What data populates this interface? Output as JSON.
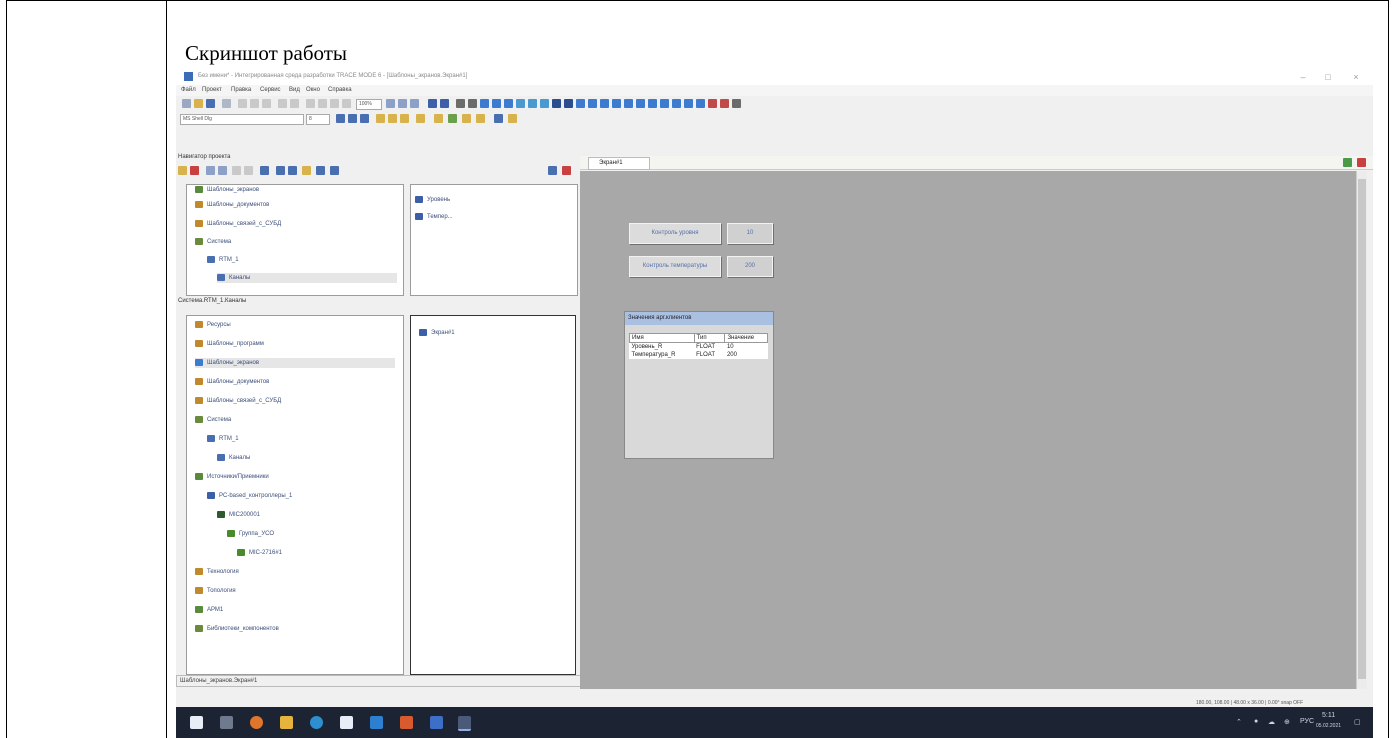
{
  "document": {
    "caption": "Скриншот работы"
  },
  "window": {
    "title": "Без имени* - Интегрированная среда разработки TRACE MODE 6 - [Шаблоны_экранов.Экран#1]",
    "buttons": {
      "minimize": "–",
      "maximize": "□",
      "close": "×"
    }
  },
  "menu": [
    "Файл",
    "Проект",
    "Правка",
    "Сервис",
    "Вид",
    "Окно",
    "Справка"
  ],
  "toolbar": {
    "zoom_value": "100%",
    "style_combo": "MS Shell Dlg",
    "size_combo": "8"
  },
  "navigator": {
    "title": "Навигатор проекта",
    "top_tree": [
      "Шаблоны_экранов",
      "Шаблоны_документов",
      "Шаблоны_связей_с_СУБД",
      "Система",
      "RTM_1",
      "Каналы"
    ],
    "top_items": [
      "Уровень",
      "Темпер..."
    ],
    "separator_label": "Система.RTM_1.Каналы",
    "main_tree": [
      "Ресурсы",
      "Шаблоны_программ",
      "Шаблоны_экранов",
      "Шаблоны_документов",
      "Шаблоны_связей_с_СУБД",
      "Система",
      "RTM_1",
      "Каналы",
      "Источники/Приемники",
      "PC-based_контроллеры_1",
      "MIC200001",
      "Группа_УСО",
      "MIC-2716#1",
      "Технология",
      "Топология",
      "АРМ1",
      "Библиотеки_компонентов"
    ],
    "right_items": [
      "Экран#1"
    ],
    "status": "Шаблоны_экранов.Экран#1"
  },
  "doc_tab": {
    "label": "Экран#1"
  },
  "hmi": {
    "btn_level": "Контроль уровня",
    "val_level": "10",
    "btn_temp": "Контроль температуры",
    "val_temp": "200"
  },
  "vars_window": {
    "title": "Значения арг.клиентов",
    "columns": [
      "Имя",
      "Тип",
      "Значение"
    ],
    "rows": [
      [
        "Уровень_R",
        "FLOAT",
        "10"
      ],
      [
        "Температура_R",
        "FLOAT",
        "200"
      ]
    ]
  },
  "status_coords": "180.00, 108.00 | 48.00 x 36.00 | 0.00°   snap OFF",
  "taskbar": {
    "lang": "РУС",
    "time": "5:11",
    "date": "05.02.2021"
  },
  "icons": [
    "start-icon",
    "search-icon",
    "firefox-icon",
    "files-icon",
    "edge-icon",
    "store-icon",
    "mail-icon",
    "app-icon",
    "word-icon",
    "trace-mode-icon"
  ]
}
